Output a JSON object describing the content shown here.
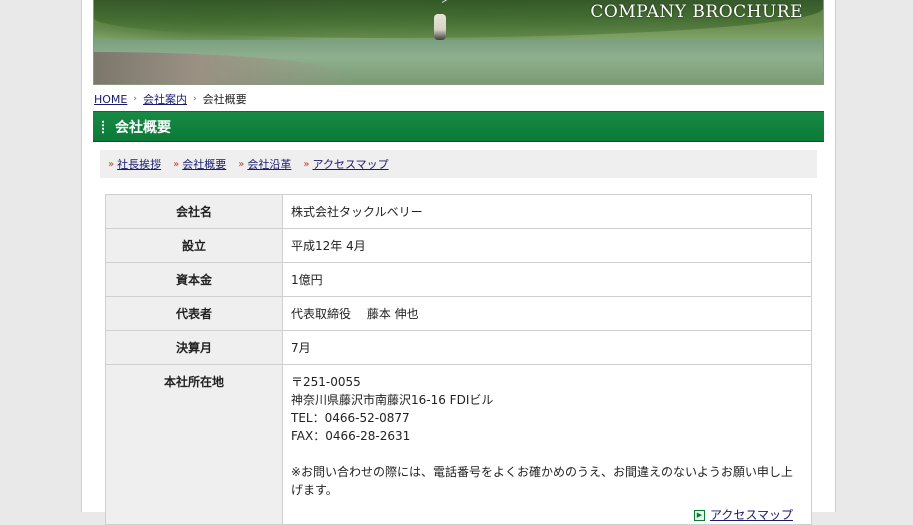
{
  "header": {
    "brochure_label": "COMPANY BROCHURE"
  },
  "breadcrumb": {
    "home": "HOME",
    "company_info": "会社案内",
    "current": "会社概要"
  },
  "page_title": "会社概要",
  "subnav": {
    "arrow": "»",
    "items": [
      "社長挨拶",
      "会社概要",
      "会社沿革",
      "アクセスマップ"
    ]
  },
  "profile": {
    "rows": [
      {
        "label": "会社名",
        "value": "株式会社タックルベリー"
      },
      {
        "label": "設立",
        "value": "平成12年 4月"
      },
      {
        "label": "資本金",
        "value": "1億円"
      },
      {
        "label": "代表者",
        "value": "代表取締役　 藤本 伸也"
      },
      {
        "label": "決算月",
        "value": "7月"
      }
    ],
    "address": {
      "label": "本社所在地",
      "postal": "〒251-0055",
      "street": "神奈川県藤沢市南藤沢16-16 FDIビル",
      "tel": "TEL：0466-52-0877",
      "fax": "FAX：0466-28-2631",
      "note": "※お問い合わせの際には、電話番号をよくお確かめのうえ、お間違えのないようお願い申し上げます。",
      "access_link": "アクセスマップ"
    }
  },
  "colors": {
    "accent_green": "#0b7a37",
    "link": "#1a1a6e",
    "subnav_arrow": "#c0392b"
  }
}
